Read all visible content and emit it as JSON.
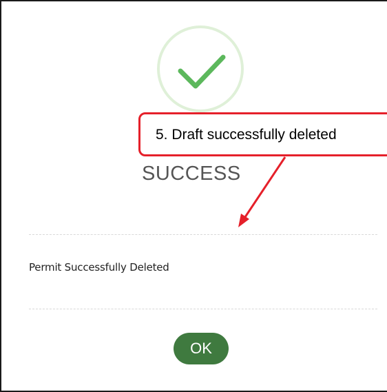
{
  "dialog": {
    "title": "SUCCESS",
    "message": "Permit Successfully Deleted",
    "ok_label": "OK",
    "icon": "checkmark-icon",
    "accent_color": "#3f7a3f",
    "icon_color": "#5cb85c"
  },
  "annotation": {
    "text": "5.  Draft successfully deleted",
    "border_color": "#e5202a"
  }
}
